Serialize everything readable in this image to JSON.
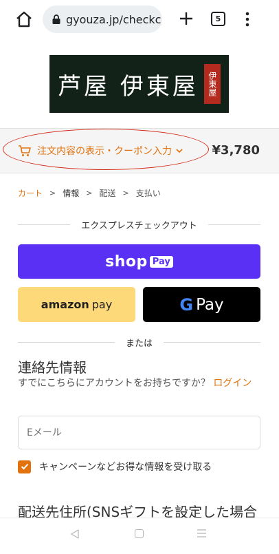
{
  "browser": {
    "url": "gyouza.jp/checkc",
    "tab_count": "5"
  },
  "logo": {
    "text": "芦屋 伊東屋",
    "seal_text": "伊東屋"
  },
  "summary": {
    "toggle_label": "注文内容の表示・クーポン入力",
    "total": "¥3,780"
  },
  "breadcrumb": {
    "items": [
      "カート",
      "情報",
      "配送",
      "支払い"
    ]
  },
  "express": {
    "heading": "エクスプレスチェックアウト",
    "shop_pay_label": "shop",
    "shop_pay_badge": "Pay",
    "amazon_prefix": "amazon",
    "amazon_suffix": "pay",
    "gpay_g": "G",
    "gpay_label": "Pay"
  },
  "or_divider": "または",
  "contact": {
    "heading": "連絡先情報",
    "login_prompt": "すでにこちらにアカウントをお持ちですか？",
    "login_link": "ログイン",
    "email_placeholder": "Eメール",
    "newsletter_label": "キャンペーンなどお得な情報を受け取る",
    "newsletter_checked": true
  },
  "shipping": {
    "heading": "配送先住所(SNSギフトを設定した場合"
  },
  "colors": {
    "accent": "#e1720e",
    "shop_pay": "#5a31f4",
    "amazon_pay": "#fdd979",
    "annotation_oval": "#d42a1a"
  }
}
